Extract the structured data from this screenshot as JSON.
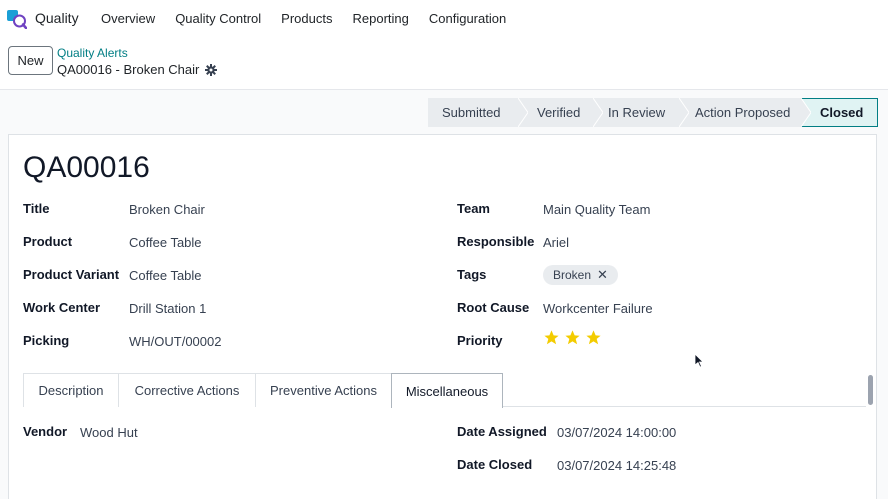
{
  "app": {
    "name": "Quality"
  },
  "menu": [
    "Overview",
    "Quality Control",
    "Products",
    "Reporting",
    "Configuration"
  ],
  "control": {
    "new_label": "New",
    "breadcrumb_parent": "Quality Alerts",
    "breadcrumb_current": "QA00016 - Broken Chair"
  },
  "stages": [
    "Submitted",
    "Verified",
    "In Review",
    "Action Proposed",
    "Closed"
  ],
  "active_stage": "Closed",
  "record": {
    "name": "QA00016",
    "left_fields": [
      {
        "label": "Title",
        "value": "Broken Chair"
      },
      {
        "label": "Product",
        "value": "Coffee Table"
      },
      {
        "label": "Product Variant",
        "value": "Coffee Table"
      },
      {
        "label": "Work Center",
        "value": "Drill Station 1"
      },
      {
        "label": "Picking",
        "value": "WH/OUT/00002"
      }
    ],
    "right_fields": {
      "team_label": "Team",
      "team": "Main Quality Team",
      "responsible_label": "Responsible",
      "responsible": "Ariel",
      "tags_label": "Tags",
      "tag": "Broken",
      "root_cause_label": "Root Cause",
      "root_cause": "Workcenter Failure",
      "priority_label": "Priority",
      "priority_stars": 3
    }
  },
  "tabs": [
    "Description",
    "Corrective Actions",
    "Preventive Actions",
    "Miscellaneous"
  ],
  "active_tab": "Miscellaneous",
  "misc": {
    "vendor_label": "Vendor",
    "vendor": "Wood Hut",
    "date_assigned_label": "Date Assigned",
    "date_assigned": "03/07/2024 14:00:00",
    "date_closed_label": "Date Closed",
    "date_closed": "03/07/2024 14:25:48"
  },
  "colors": {
    "brand": "#017e84",
    "star": "#f3cc00",
    "stage_bg": "#e9ecef"
  }
}
